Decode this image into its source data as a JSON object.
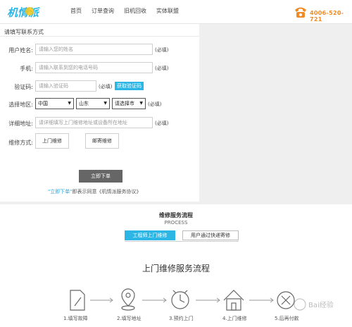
{
  "header": {
    "logo_text": "机情派",
    "nav": [
      "首页",
      "订单查询",
      "旧机回收",
      "实体联盟"
    ],
    "phone": "4006-520-721"
  },
  "form": {
    "section_title": "请填写联系方式",
    "name": {
      "label": "用户姓名:",
      "placeholder": "请输入您的姓名",
      "required": "(必填)"
    },
    "mobile": {
      "label": "手机:",
      "placeholder": "请输入联系到您的电话号码",
      "required": "(必填)"
    },
    "code": {
      "label": "验证码:",
      "placeholder": "请输入验证码",
      "required": "(必填)",
      "button": "获取验证码"
    },
    "region": {
      "label": "选择地区:",
      "country": "中国",
      "province": "山东",
      "city": "请选择市",
      "required": "(必填)"
    },
    "address": {
      "label": "详细地址:",
      "placeholder": "请详细填写上门维修地址或设备所在地址",
      "required": "(必填)"
    },
    "method": {
      "label": "维修方式:",
      "options": [
        "上门维修",
        "邮寄维修"
      ]
    },
    "submit": "立即下单",
    "agree_highlight": "\"立即下单\"",
    "agree_text": "即表示同意《机情派服务协议》"
  },
  "process": {
    "title": "维修服务流程",
    "subtitle": "PROCESS",
    "tab_active": "工程师上门维修",
    "tab_inactive": "用户通过快递寄修",
    "flow_title": "上门维修服务流程",
    "steps": [
      "1.填写故障",
      "2.填写地址",
      "3.预约上门",
      "4.上门维修",
      "5.后再付款"
    ]
  },
  "watermark": "Bai经验",
  "colors": {
    "accent": "#2bb6e6",
    "phone": "#f08a24",
    "submit": "#666666"
  }
}
